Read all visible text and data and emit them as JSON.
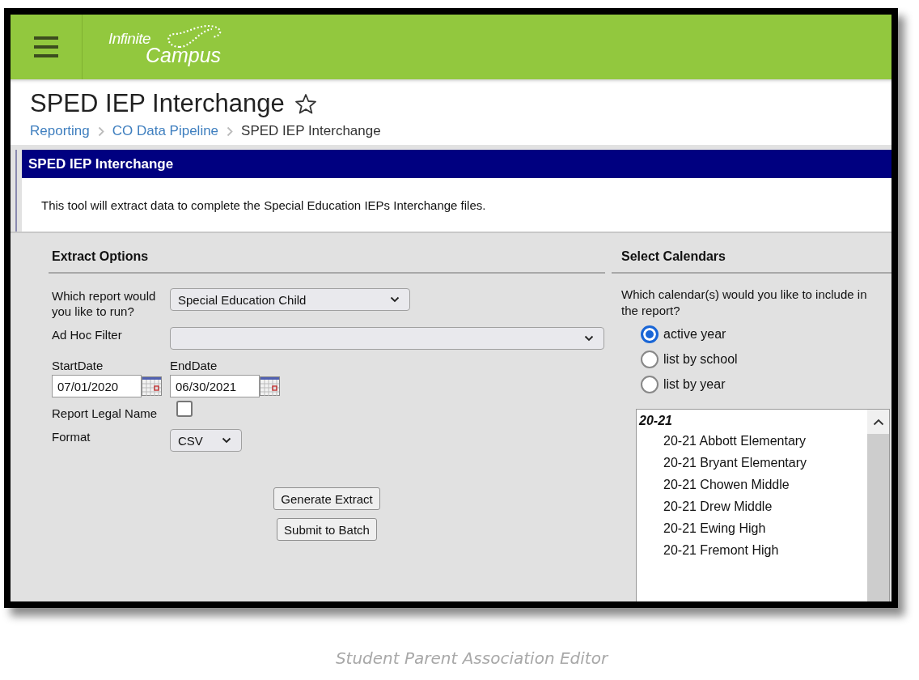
{
  "header": {
    "logo": {
      "line1": "Infinite",
      "line2": "Campus"
    }
  },
  "page": {
    "title": "SPED IEP Interchange",
    "favorite": false,
    "breadcrumb": [
      {
        "label": "Reporting",
        "link": true
      },
      {
        "label": "CO Data Pipeline",
        "link": true
      },
      {
        "label": "SPED IEP Interchange",
        "link": false
      }
    ]
  },
  "tool": {
    "title": "SPED IEP Interchange",
    "description": "This tool will extract data to complete the Special Education IEPs Interchange files."
  },
  "extract_options": {
    "heading": "Extract Options",
    "fields": [
      {
        "kind": "select",
        "label": "Which report would you like to run?",
        "value": "Special Education Child"
      },
      {
        "kind": "filter",
        "label": "Ad Hoc Filter"
      },
      {
        "kind": "dates",
        "start_label": "StartDate",
        "start_value": "07/01/2020",
        "end_label": "EndDate",
        "end_value": "06/30/2021"
      },
      {
        "kind": "checkbox",
        "label": "Report Legal Name",
        "checked": false
      },
      {
        "kind": "format",
        "label": "Format",
        "value": "CSV"
      }
    ],
    "buttons": [
      "Generate Extract",
      "Submit to Batch"
    ]
  },
  "select_calendars": {
    "heading": "Select Calendars",
    "question": "Which calendar(s) would you like to include in the report?",
    "options": [
      {
        "label": "active year",
        "selected": true
      },
      {
        "label": "list by school",
        "selected": false
      },
      {
        "label": "list by year",
        "selected": false
      }
    ],
    "list": {
      "group": "20-21",
      "items": [
        "20-21 Abbott Elementary",
        "20-21 Bryant Elementary",
        "20-21 Chowen Middle",
        "20-21 Drew Middle",
        "20-21 Ewing High",
        "20-21 Fremont High"
      ]
    }
  },
  "caption": "Student Parent Association Editor"
}
